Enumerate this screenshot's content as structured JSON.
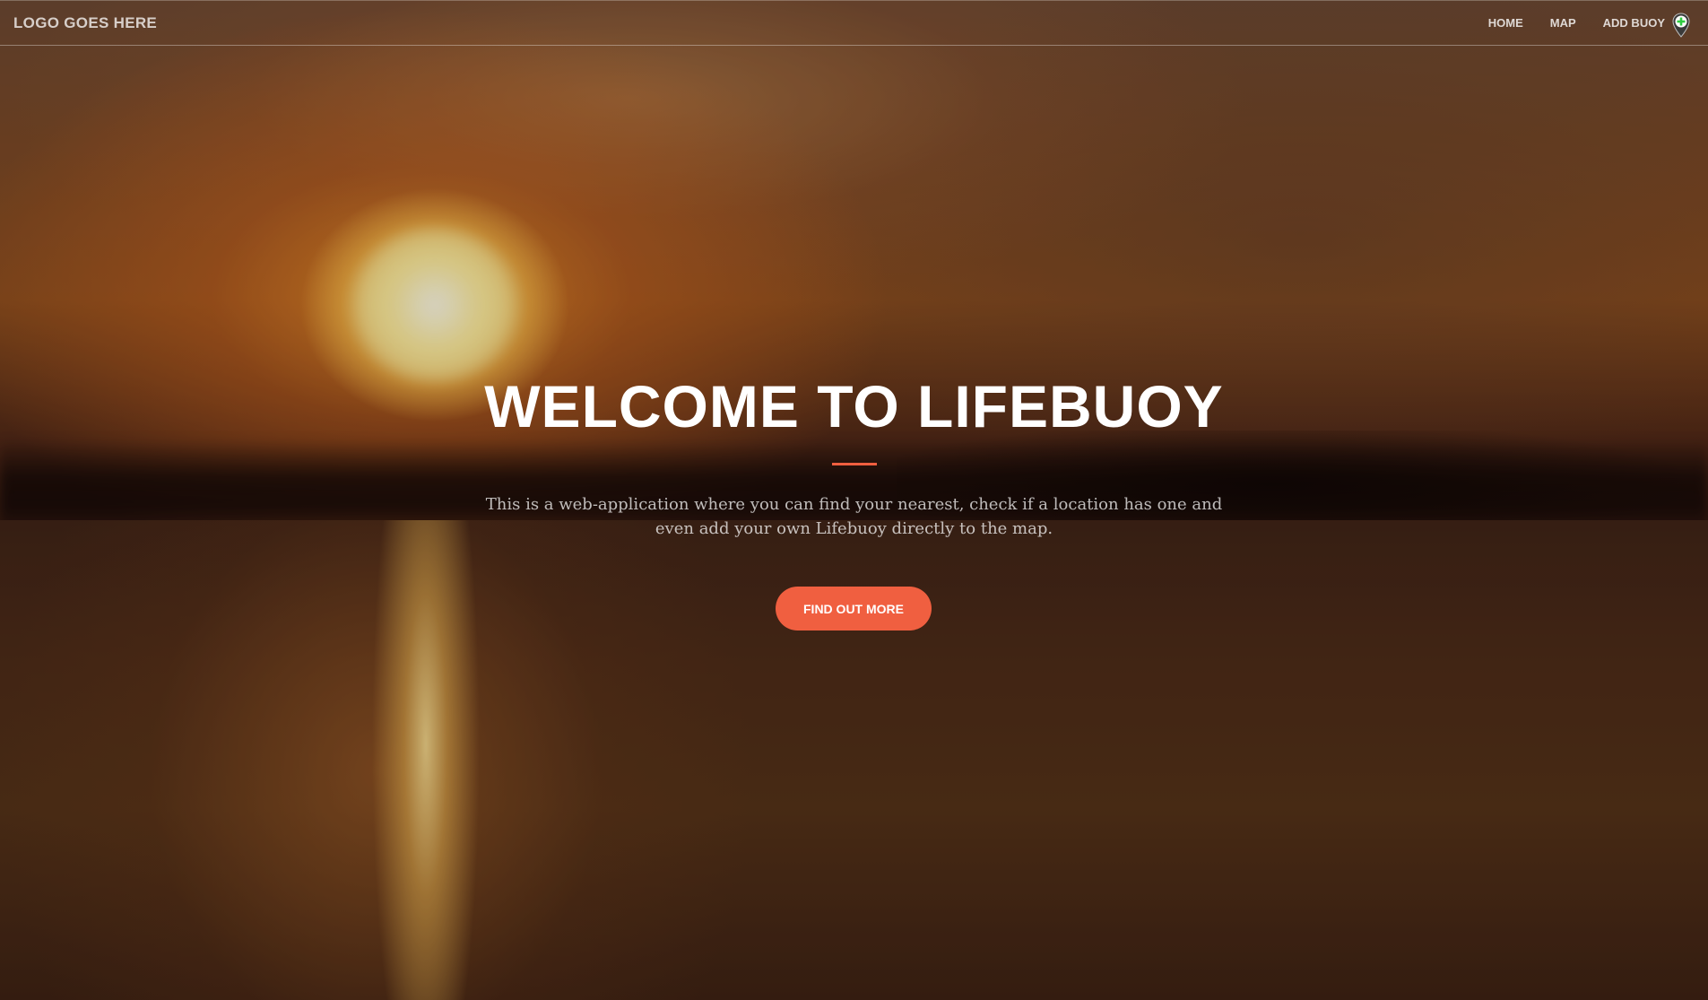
{
  "navbar": {
    "brand": "LOGO GOES HERE",
    "links": [
      {
        "label": "HOME"
      },
      {
        "label": "MAP"
      },
      {
        "label": "ADD BUOY",
        "icon": "map-pin-plus-icon"
      }
    ]
  },
  "hero": {
    "title": "WELCOME TO LIFEBUOY",
    "subtitle": "This is a web-application where you can find your nearest, check if a location has one and even add your own Lifebuoy directly to the map.",
    "cta_label": "FIND OUT MORE"
  },
  "colors": {
    "accent": "#f05f40",
    "text": "#ffffff",
    "pin_green": "#2ecc40"
  }
}
